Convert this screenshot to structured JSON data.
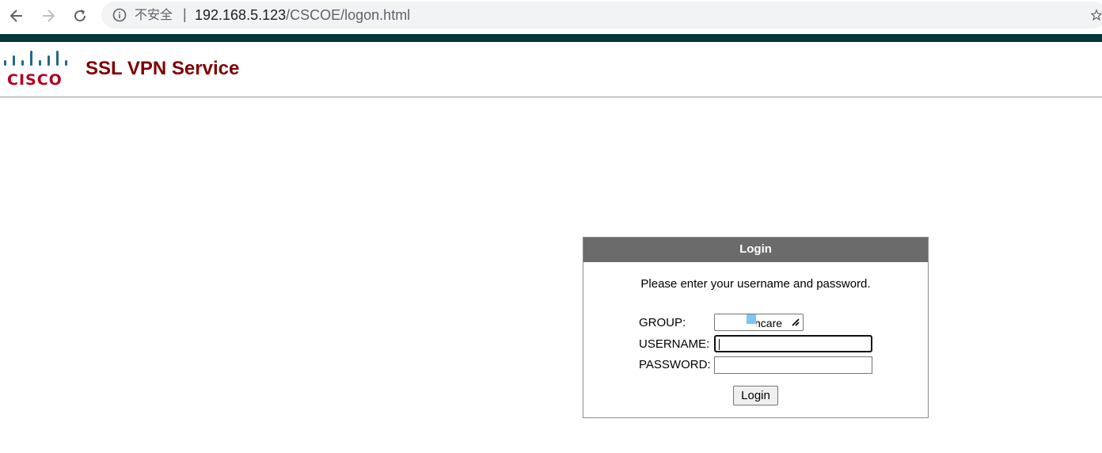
{
  "browser": {
    "security_label": "不安全",
    "separator": "|",
    "url_host": "192.168.5.123",
    "url_path": "/CSCOE/logon.html"
  },
  "header": {
    "logo_text": "CISCO",
    "title": "SSL VPN Service"
  },
  "login": {
    "title": "Login",
    "instructions": "Please enter your username and password.",
    "group_label": "GROUP:",
    "group_value": "ncare",
    "username_label": "USERNAME:",
    "username_value": "",
    "password_label": "PASSWORD:",
    "password_value": "",
    "button_label": "Login"
  },
  "colors": {
    "band": "#07363a",
    "title": "#800000",
    "logo": "#b3011e",
    "login_header_bg": "#6b6b6b"
  }
}
